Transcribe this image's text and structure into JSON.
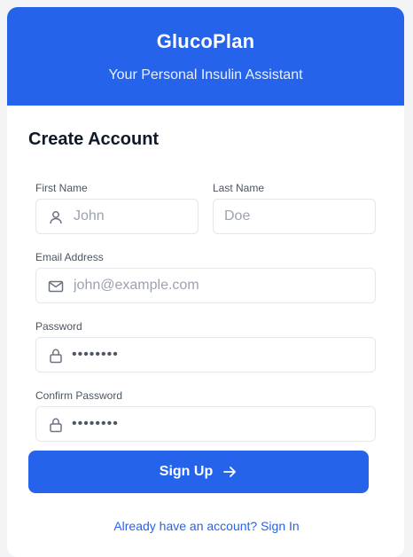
{
  "header": {
    "title": "GlucoPlan",
    "subtitle": "Your Personal Insulin Assistant",
    "color": "#2563eb"
  },
  "form": {
    "title": "Create Account",
    "first_name": {
      "label": "First Name",
      "placeholder": "John",
      "icon": "user-icon"
    },
    "last_name": {
      "label": "Last Name",
      "placeholder": "Doe"
    },
    "email": {
      "label": "Email Address",
      "placeholder": "john@example.com",
      "icon": "mail-icon"
    },
    "password": {
      "label": "Password",
      "value": "••••••••",
      "icon": "lock-icon"
    },
    "confirm_password": {
      "label": "Confirm Password",
      "value": "••••••••",
      "icon": "lock-icon"
    },
    "submit_label": "Sign Up",
    "submit_icon": "arrow-right-icon",
    "signin_link": "Already have an account? Sign In"
  }
}
